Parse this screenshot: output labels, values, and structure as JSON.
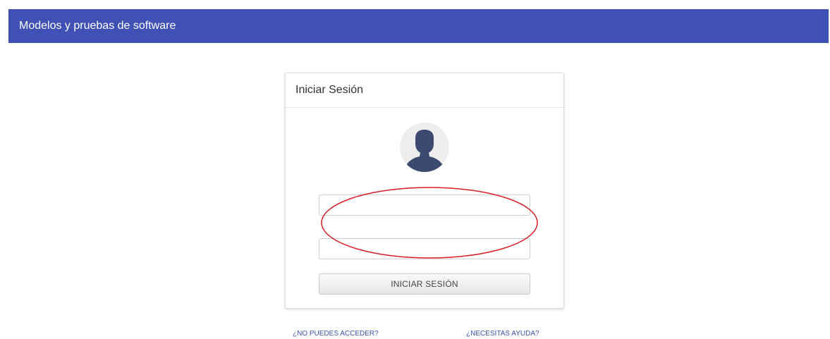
{
  "header": {
    "title": "Modelos y pruebas de software"
  },
  "login_card": {
    "title": "Iniciar Sesión",
    "avatar_icon": "user-silhouette-icon",
    "username_input": {
      "value": "",
      "placeholder": ""
    },
    "password_input": {
      "value": "",
      "placeholder": ""
    },
    "submit_label": "INICIAR SESIÓN"
  },
  "footer_links": {
    "cant_access": "¿NO PUEDES ACCEDER?",
    "need_help": "¿NECESITAS AYUDA?"
  },
  "colors": {
    "brand": "#3f51b5",
    "avatar_figure": "#3b4a6e",
    "annotation": "#d81f26"
  }
}
